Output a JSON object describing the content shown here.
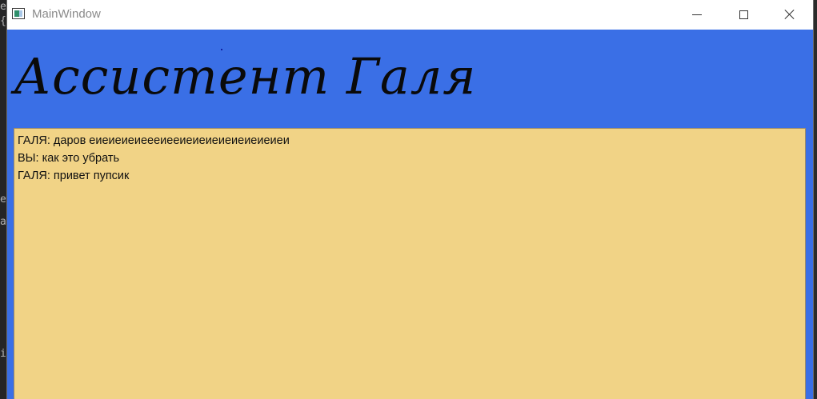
{
  "window": {
    "title": "MainWindow",
    "icon": "app-window-icon",
    "controls": {
      "minimize": "minimize-icon",
      "maximize": "maximize-icon",
      "close": "close-icon"
    }
  },
  "backdrop": {
    "glyphs": [
      "e",
      "{",
      "e",
      "a",
      "i"
    ]
  },
  "header": {
    "title": "Ассистент Галя"
  },
  "chat": {
    "messages": [
      "ГАЛЯ: даров еиеиеиеиеееиееиеиеиеиеиеиеиеиеи",
      "ВЫ: как это убрать",
      "ГАЛЯ: привет пупсик"
    ]
  },
  "colors": {
    "header_background": "#3a6fe6",
    "chat_background": "#f1d386",
    "title_text": "#0a0a0a"
  }
}
